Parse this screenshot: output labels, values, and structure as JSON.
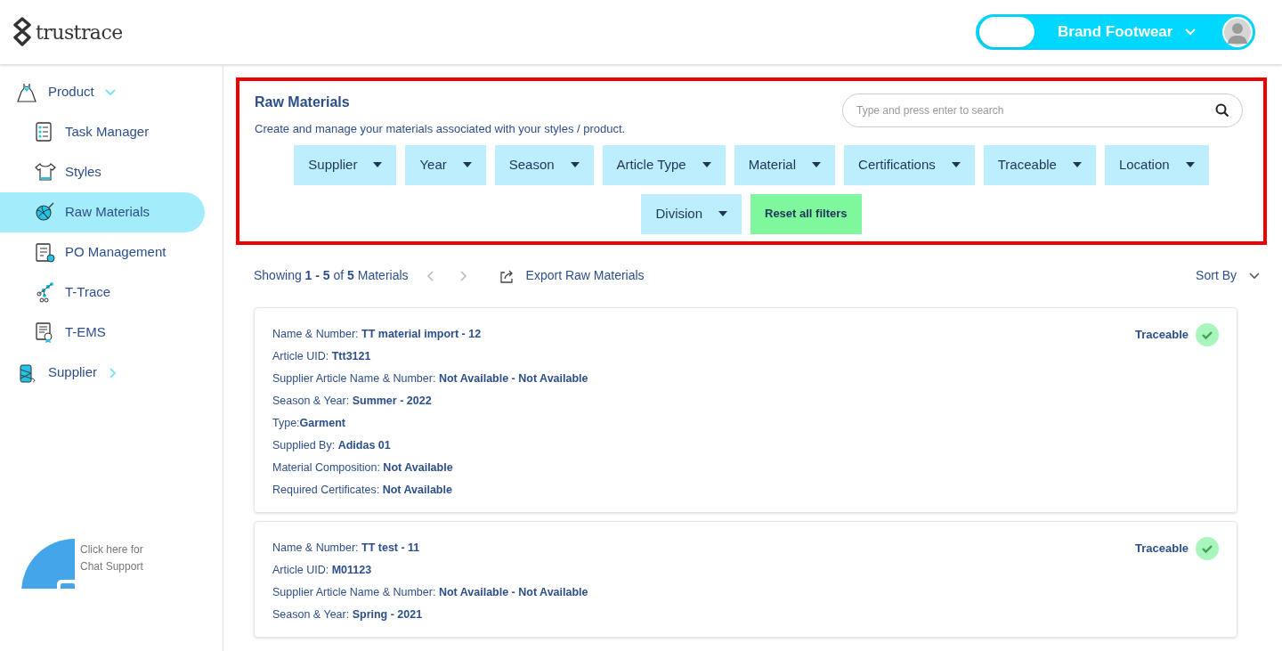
{
  "header": {
    "logo": "trustrace",
    "account": {
      "toggle_on": false,
      "brand": "Brand Footwear"
    }
  },
  "sidebar": {
    "items": [
      {
        "label": "Product",
        "expanded": true,
        "children": [
          {
            "label": "Task Manager",
            "selected": false
          },
          {
            "label": "Styles",
            "selected": false
          },
          {
            "label": "Raw Materials",
            "selected": true
          },
          {
            "label": "PO Management",
            "selected": false
          },
          {
            "label": "T-Trace",
            "selected": false
          },
          {
            "label": "T-EMS",
            "selected": false
          }
        ]
      },
      {
        "label": "Supplier",
        "expanded": false
      }
    ],
    "chat": "Click here for Chat Support"
  },
  "filter_panel": {
    "title": "Raw Materials",
    "subtitle": "Create and manage your materials associated with your styles / product.",
    "search": {
      "placeholder": "Type and press enter to search"
    },
    "filters": [
      "Supplier",
      "Year",
      "Season",
      "Article Type",
      "Material",
      "Certifications",
      "Traceable",
      "Location",
      "Division"
    ],
    "reset": "Reset all filters"
  },
  "toolbar": {
    "showing": "Showing **1 - 5** of **5** Materials",
    "export": "Export Raw Materials",
    "sort": "Sort By"
  },
  "materials": [
    {
      "traceable": true,
      "status": "Traceable",
      "fields": [
        "Name & Number: **TT material import - 12**",
        "Article UID: **Ttt3121**",
        "Supplier Article Name & Number: **Not Available - Not Available**",
        "Season & Year: **Summer - 2022**",
        "Type:**Garment**",
        "Supplied By: **Adidas 01**",
        "Material Composition: **Not Available**",
        "Required Certificates: **Not Available**"
      ]
    },
    {
      "traceable": true,
      "status": "Traceable",
      "fields": [
        "Name & Number: **TT test - 11**",
        "Article UID: **M01123**",
        "Supplier Article Name & Number: **Not Available - Not Available**",
        "Season & Year: **Spring - 2021**"
      ]
    }
  ]
}
